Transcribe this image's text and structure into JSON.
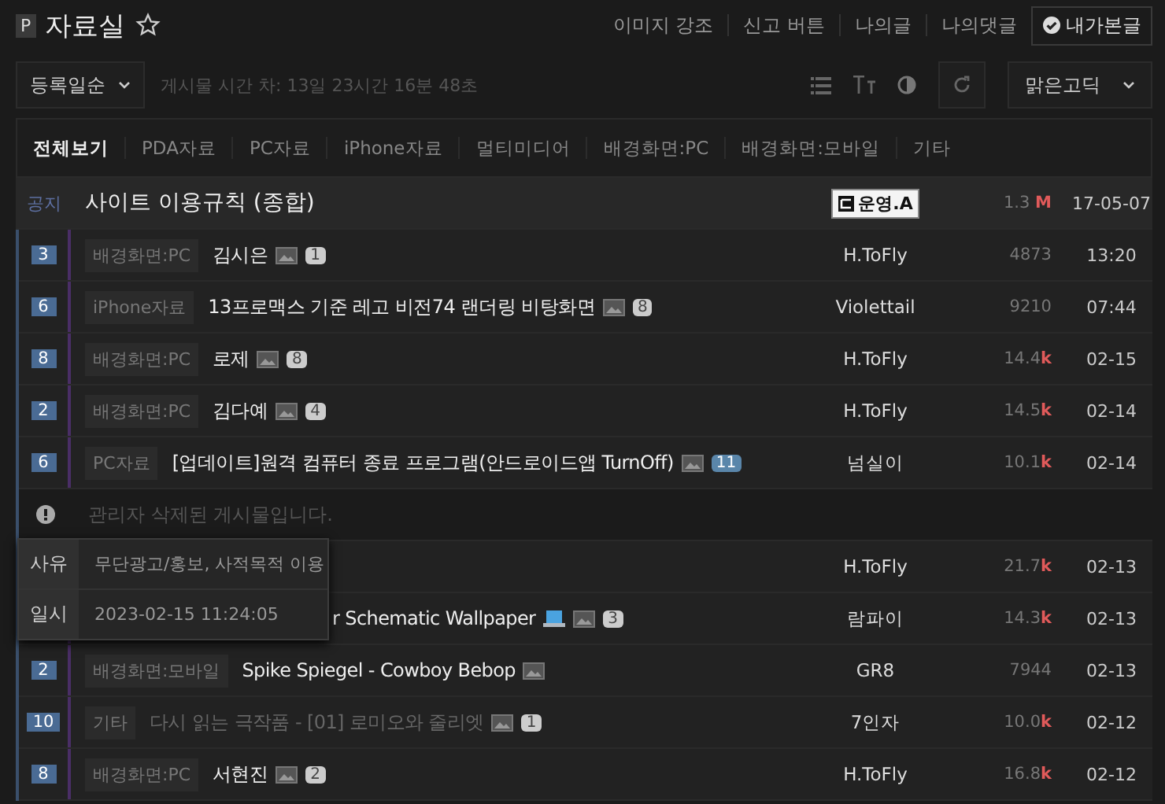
{
  "header": {
    "badge": "P",
    "title": "자료실",
    "links": [
      "이미지 강조",
      "신고 버튼",
      "나의글",
      "나의댓글"
    ],
    "viewed_button": "내가본글"
  },
  "toolbar": {
    "sort": "등록일순",
    "time_diff": "게시물 시간 차: 13일 23시간 16분 48초",
    "font": "맑은고딕"
  },
  "tabs": [
    {
      "label": "전체보기",
      "selected": true
    },
    {
      "label": "PDA자료",
      "selected": false
    },
    {
      "label": "PC자료",
      "selected": false
    },
    {
      "label": "iPhone자료",
      "selected": false
    },
    {
      "label": "멀티미디어",
      "selected": false
    },
    {
      "label": "배경화면:PC",
      "selected": false
    },
    {
      "label": "배경화면:모바일",
      "selected": false
    },
    {
      "label": "기타",
      "selected": false
    }
  ],
  "notice": {
    "label": "공지",
    "title": "사이트 이용규칙 (종합)",
    "author": "운영.A",
    "views": "1.3",
    "unit": "M",
    "date": "17-05-07"
  },
  "rows": [
    {
      "kind": "post",
      "number": "3",
      "category": "배경화면:PC",
      "title": "김시은",
      "image": true,
      "comments": "1",
      "comments_new": false,
      "read": false,
      "author": "H.ToFly",
      "views": "4873",
      "date": "13:20"
    },
    {
      "kind": "post",
      "number": "6",
      "category": "iPhone자료",
      "title": "13프로맥스 기준 레고 비전74 랜더링 비탕화면",
      "image": true,
      "comments": "8",
      "comments_new": false,
      "read": false,
      "author": "Violettail",
      "views": "9210",
      "date": "07:44"
    },
    {
      "kind": "post",
      "number": "8",
      "category": "배경화면:PC",
      "title": "로제",
      "image": true,
      "comments": "8",
      "comments_new": false,
      "read": false,
      "author": "H.ToFly",
      "views": "14.4",
      "unit": "k",
      "date": "02-15"
    },
    {
      "kind": "post",
      "number": "2",
      "category": "배경화면:PC",
      "title": "김다예",
      "image": true,
      "comments": "4",
      "comments_new": false,
      "read": false,
      "author": "H.ToFly",
      "views": "14.5",
      "unit": "k",
      "date": "02-14"
    },
    {
      "kind": "post",
      "number": "6",
      "category": "PC자료",
      "title": "[업데이트]원격 컴퓨터 종료 프로그램(안드로이드앱 TurnOff)",
      "image": true,
      "comments": "11",
      "comments_new": true,
      "read": false,
      "author": "넘실이",
      "views": "10.1",
      "unit": "k",
      "date": "02-14"
    },
    {
      "kind": "deleted",
      "text": "관리자 삭제된 게시물입니다."
    },
    {
      "kind": "post",
      "author": "H.ToFly",
      "views": "21.7",
      "unit": "k",
      "date": "02-13"
    },
    {
      "kind": "post",
      "title": "r Schematic Wallpaper",
      "laptop": true,
      "image": true,
      "comments": "3",
      "comments_new": false,
      "read": false,
      "author": "람파이",
      "views": "14.3",
      "unit": "k",
      "date": "02-13"
    },
    {
      "kind": "post",
      "number": "2",
      "category": "배경화면:모바일",
      "title": "Spike Spiegel - Cowboy Bebop",
      "image": true,
      "read": false,
      "author": "GR8",
      "views": "7944",
      "date": "02-13"
    },
    {
      "kind": "post",
      "number": "10",
      "category": "기타",
      "title": "다시 읽는 극작품 - [01] 로미오와 줄리엣",
      "image": true,
      "comments": "1",
      "comments_new": false,
      "read": true,
      "author": "7인자",
      "views": "10.0",
      "unit": "k",
      "date": "02-12"
    },
    {
      "kind": "post",
      "number": "8",
      "category": "배경화면:PC",
      "title": "서현진",
      "image": true,
      "comments": "2",
      "comments_new": false,
      "read": false,
      "author": "H.ToFly",
      "views": "16.8",
      "unit": "k",
      "date": "02-12"
    }
  ],
  "tooltip": [
    {
      "label": "사유",
      "value": "무단광고/홍보, 사적목적 이용"
    },
    {
      "label": "일시",
      "value": "2023-02-15 11:24:05"
    }
  ]
}
